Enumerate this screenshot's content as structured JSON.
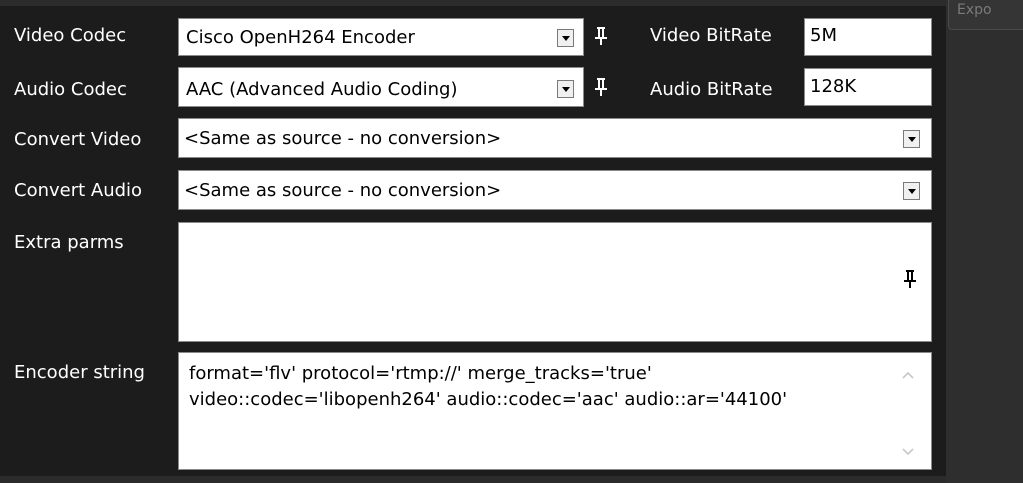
{
  "header_button": {
    "label": "Expo"
  },
  "video_codec": {
    "label": "Video Codec",
    "value": "Cisco OpenH264 Encoder"
  },
  "video_bitrate": {
    "label": "Video BitRate",
    "value": "5M"
  },
  "audio_codec": {
    "label": "Audio Codec",
    "value": "AAC (Advanced Audio Coding)"
  },
  "audio_bitrate": {
    "label": "Audio BitRate",
    "value": "128K"
  },
  "convert_video": {
    "label": "Convert Video",
    "value": "<Same as source - no conversion>"
  },
  "convert_audio": {
    "label": "Convert Audio",
    "value": "<Same as source - no conversion>"
  },
  "extra_parms": {
    "label": "Extra parms",
    "value": ""
  },
  "encoder_string": {
    "label": "Encoder string",
    "lines": [
      "format='flv' protocol='rtmp://' merge_tracks='true'",
      "video::codec='libopenh264' audio::codec='aac' audio::ar='44100'"
    ]
  },
  "icons": [
    "dropdown-arrow-icon",
    "pin-icon",
    "scroll-up-arrow-icon",
    "scroll-down-arrow-icon"
  ],
  "colors": {
    "background": "#1c1c1c",
    "label_text": "#ffffff",
    "field_bg": "#ffffff"
  }
}
